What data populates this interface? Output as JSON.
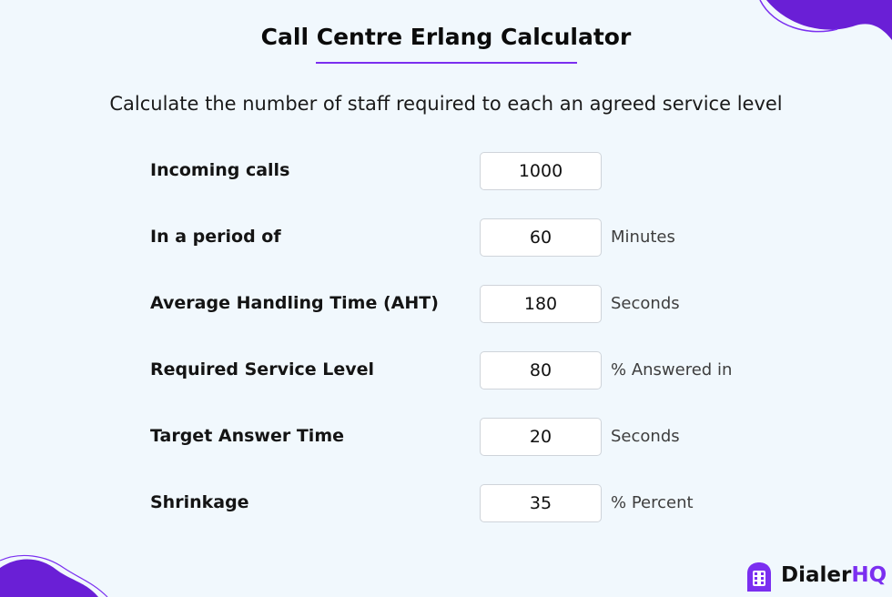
{
  "title": "Call Centre Erlang Calculator",
  "subtitle": "Calculate the number of staff required to each an agreed service level",
  "fields": [
    {
      "label": "Incoming calls",
      "value": "1000",
      "unit": ""
    },
    {
      "label": "In a period of",
      "value": "60",
      "unit": "Minutes"
    },
    {
      "label": "Average Handling Time (AHT)",
      "value": "180",
      "unit": "Seconds"
    },
    {
      "label": "Required Service Level",
      "value": "80",
      "unit": "% Answered in"
    },
    {
      "label": "Target Answer Time",
      "value": "20",
      "unit": "Seconds"
    },
    {
      "label": "Shrinkage",
      "value": "35",
      "unit": "% Percent"
    }
  ],
  "logo": {
    "name_main": "Dialer",
    "name_accent": "HQ"
  },
  "colors": {
    "background": "#f1f8fd",
    "accent": "#7b2ff0",
    "blob": "#6a1fd6"
  }
}
